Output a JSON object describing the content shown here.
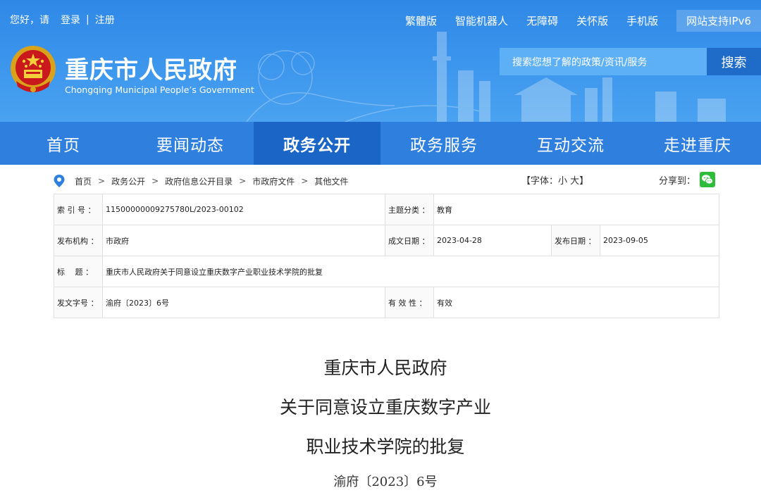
{
  "topbar": {
    "greeting": "您好，请",
    "login": "登录",
    "divider": "|",
    "register": "注册",
    "links": [
      "繁體版",
      "智能机器人",
      "无障碍",
      "关怀版",
      "手机版"
    ],
    "ipv6": "网站支持IPv6"
  },
  "site": {
    "title": "重庆市人民政府",
    "subtitle": "Chongqing Municipal People’s Government"
  },
  "search": {
    "placeholder": "搜索您想了解的政策/资讯/服务",
    "button": "搜索"
  },
  "nav": [
    "首页",
    "要闻动态",
    "政务公开",
    "政务服务",
    "互动交流",
    "走进重庆"
  ],
  "nav_active": 2,
  "breadcrumb": [
    "首页",
    "政务公开",
    "政府信息公开目录",
    "市政府文件",
    "其他文件"
  ],
  "breadcrumb_sep": ">",
  "font_size": {
    "open": "【字体：",
    "small": "小",
    "large": "大",
    "close": "】"
  },
  "share_label": "分享到：",
  "info": {
    "row1": {
      "l1": "索 引 号 ：",
      "v1": "11500000009275780L/2023-00102",
      "l2": "主题分类 ：",
      "v2": "教育"
    },
    "row2": {
      "l1": "发布机构 ：",
      "v1": "市政府",
      "l2": "成文日期 ：",
      "v2": "2023-04-28",
      "l3": "发布日期 ：",
      "v3": "2023-09-05"
    },
    "row3": {
      "l1": "标　 题 ：",
      "v1": "重庆市人民政府关于同意设立重庆数字产业职业技术学院的批复"
    },
    "row4": {
      "l1": "发文字号 ：",
      "v1": "渝府〔2023〕6号",
      "l2": "有 效 性 ：",
      "v2": "有效"
    }
  },
  "document": {
    "title_lines": [
      "重庆市人民政府",
      "关于同意设立重庆数字产业",
      "职业技术学院的批复"
    ],
    "number": "渝府〔2023〕6号"
  },
  "colors": {
    "header": "#3a94ec",
    "nav": "#2f7fdf",
    "nav_active": "#1b65c6",
    "search_btn": "#1e6cc8"
  }
}
